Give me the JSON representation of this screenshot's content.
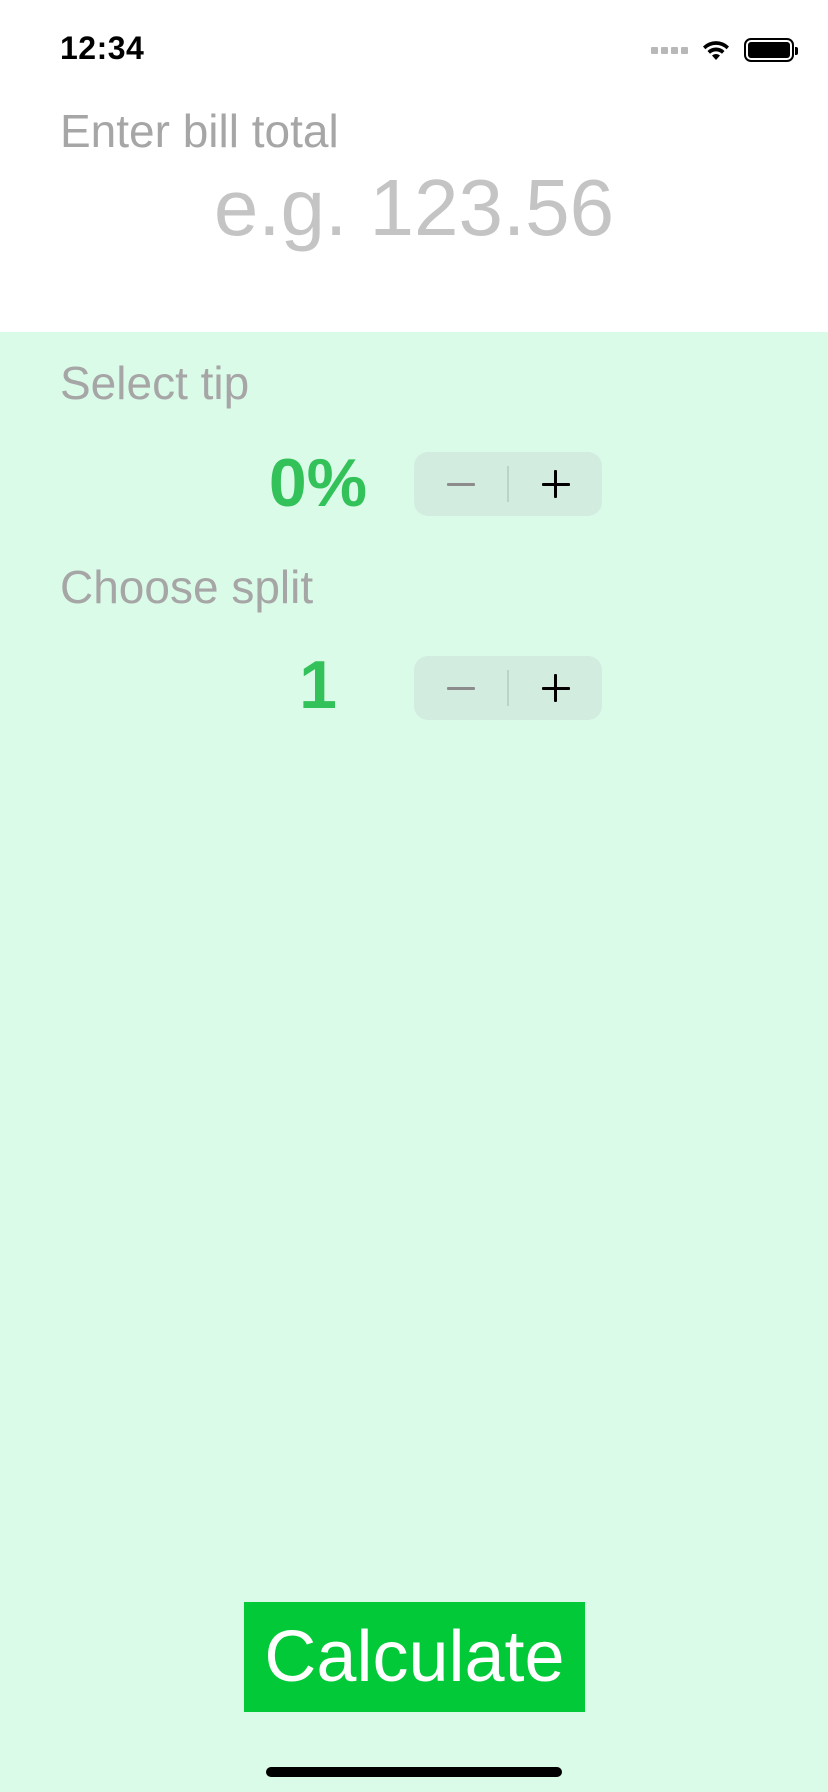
{
  "status_bar": {
    "time": "12:34",
    "icons": [
      "cellular-signal-icon",
      "wifi-icon",
      "battery-icon"
    ]
  },
  "bill": {
    "label": "Enter bill total",
    "value": "",
    "placeholder": "e.g. 123.56"
  },
  "tip": {
    "label": "Select tip",
    "value": "0%"
  },
  "split": {
    "label": "Choose split",
    "value": "1"
  },
  "actions": {
    "calculate_label": "Calculate"
  },
  "colors": {
    "background_green": "#dbfbe9",
    "accent_green": "#33c25a",
    "button_green": "#02c937",
    "label_gray": "#a6a6a6",
    "placeholder_gray": "#c4c4c4"
  }
}
